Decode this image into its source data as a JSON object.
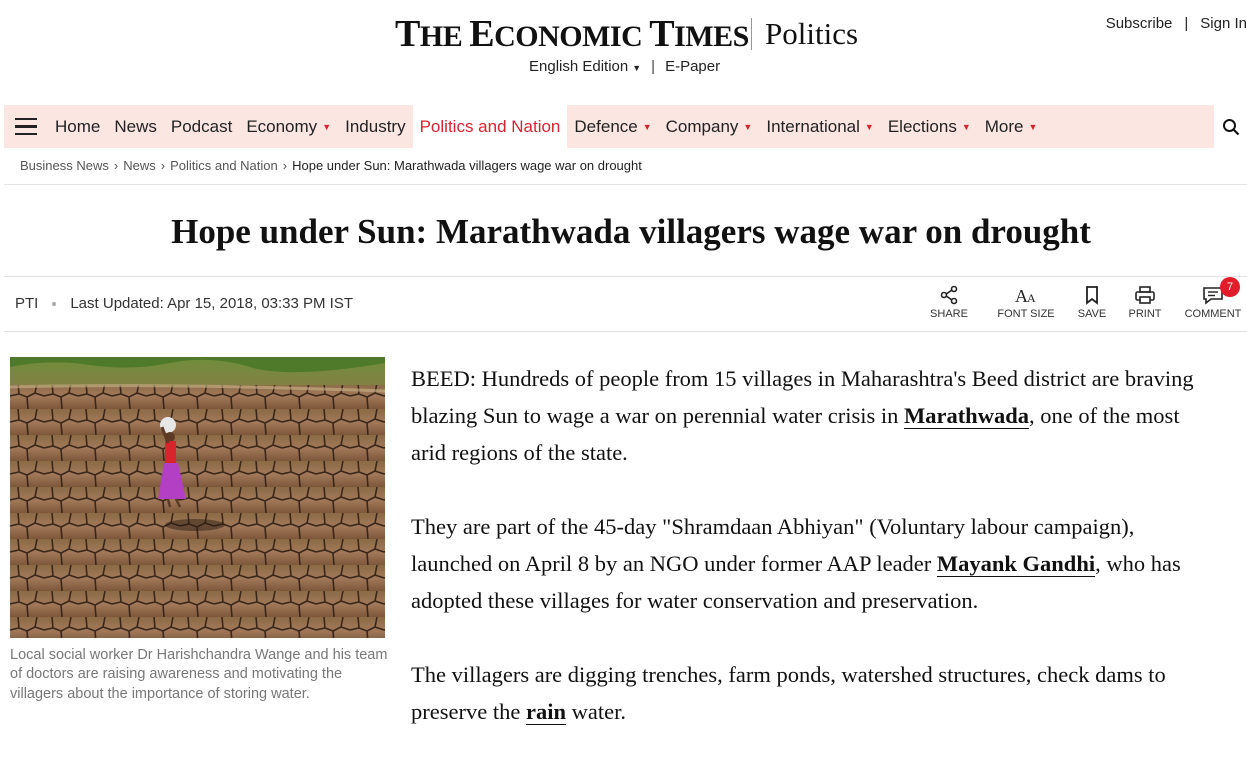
{
  "header": {
    "logo_prefix": "T",
    "logo_word1": "HE ",
    "logo_E": "E",
    "logo_word2": "CONOMIC ",
    "logo_T": "T",
    "logo_word3": "IMES",
    "section": "Politics",
    "edition": "English Edition",
    "epaper": "E-Paper",
    "subscribe": "Subscribe",
    "signin": "Sign In"
  },
  "nav": {
    "items": [
      {
        "label": "Home"
      },
      {
        "label": "News"
      },
      {
        "label": "Podcast"
      },
      {
        "label": "Economy"
      },
      {
        "label": "Industry"
      },
      {
        "label": "Politics and Nation"
      },
      {
        "label": "Defence"
      },
      {
        "label": "Company"
      },
      {
        "label": "International"
      },
      {
        "label": "Elections"
      },
      {
        "label": "More"
      }
    ]
  },
  "breadcrumb": [
    "Business News",
    "News",
    "Politics and Nation",
    "Hope under Sun: Marathwada villagers wage war on drought"
  ],
  "article": {
    "title": "Hope under Sun: Marathwada villagers wage war on drought",
    "source": "PTI",
    "updated": "Last Updated: Apr 15, 2018, 03:33 PM IST",
    "caption": "Local social worker Dr Harishchandra Wange and his team of doctors are raising awareness and motivating the villagers about the importance of storing water.",
    "p1_a": "BEED: Hundreds of people from 15 villages in Maharashtra's Beed district are braving blazing Sun to wage a war on perennial water crisis in ",
    "p1_link": "Marathwada",
    "p1_b": ", one of the most arid regions of the state.",
    "p2_a": "They are part of the 45-day \"Shramdaan Abhiyan\" (Voluntary labour campaign), launched on April 8 by an NGO under former AAP leader ",
    "p2_link": "Mayank Gandhi",
    "p2_b": ", who has adopted these villages for water conservation and preservation.",
    "p3_a": "The villagers are digging trenches, farm ponds, watershed structures, check dams to preserve the ",
    "p3_link": "rain",
    "p3_b": " water."
  },
  "tools": {
    "share": "SHARE",
    "font_size": "FONT SIZE",
    "save": "SAVE",
    "print": "PRINT",
    "comment": "COMMENT",
    "comment_count": "7"
  },
  "colors": {
    "accent": "#d9232d",
    "nav_bg": "#fbe6e2"
  }
}
